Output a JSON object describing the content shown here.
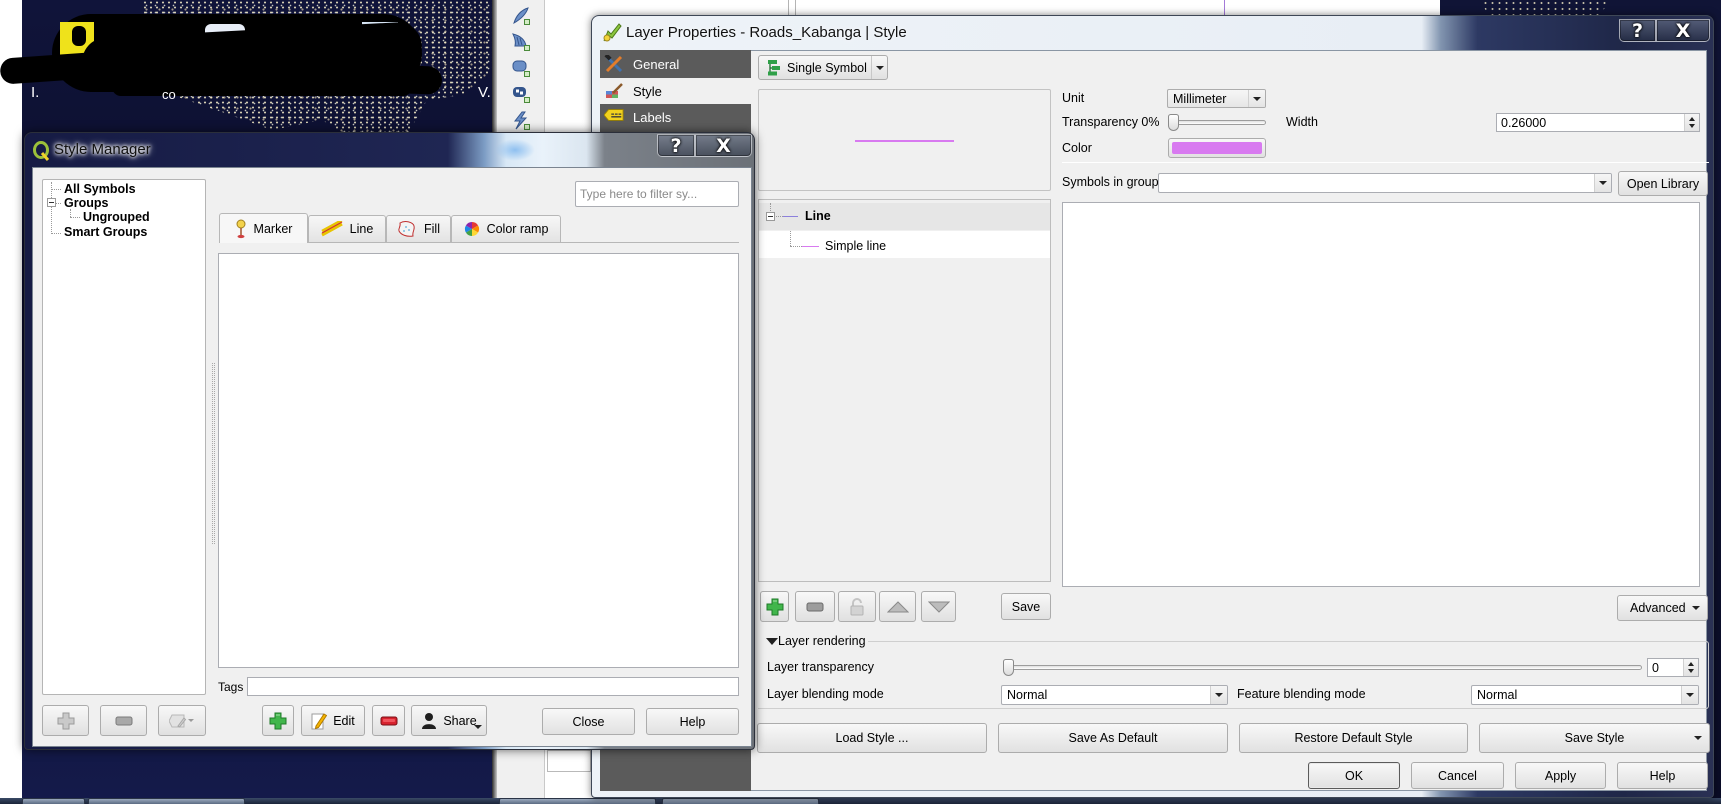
{
  "desktop": {
    "map_labels": [
      "I.",
      "co",
      "V."
    ]
  },
  "layer_properties": {
    "title": "Layer Properties - Roads_Kabanga | Style",
    "caption_help": "?",
    "caption_close": "X",
    "sidebar": [
      {
        "label": "General",
        "icon": "tools-icon",
        "selected": false
      },
      {
        "label": "Style",
        "icon": "paintbrush-icon",
        "selected": true
      },
      {
        "label": "Labels",
        "icon": "abc-tag-icon",
        "selected": false
      }
    ],
    "renderer_type": "Single Symbol",
    "symbol_tree": {
      "root": "Line",
      "child": "Simple line"
    },
    "save_label": "Save",
    "unit_label": "Unit",
    "unit_value": "Millimeter",
    "transparency_label": "Transparency 0%",
    "transparency_percent": 0,
    "width_label": "Width",
    "width_value": "0.26000",
    "color_label": "Color",
    "symbol_color": "#d87af0",
    "root_line_color": "#8c80dc",
    "symbols_in_group_label": "Symbols in group",
    "symbols_in_group_value": "",
    "open_library_label": "Open Library",
    "advanced_label": "Advanced",
    "layer_rendering": {
      "title": "Layer rendering",
      "transparency_label": "Layer transparency",
      "transparency_value": "0",
      "blending_label": "Layer blending mode",
      "blending_value": "Normal",
      "feature_blending_label": "Feature blending mode",
      "feature_blending_value": "Normal"
    },
    "style_buttons": {
      "load": "Load Style ...",
      "save_default": "Save As Default",
      "restore_default": "Restore Default Style",
      "save_style": "Save Style"
    },
    "buttons": {
      "ok": "OK",
      "cancel": "Cancel",
      "apply": "Apply",
      "help": "Help"
    }
  },
  "style_manager": {
    "title": "Style Manager",
    "caption_help": "?",
    "caption_close": "X",
    "groups_tree": [
      {
        "label": "All Symbols",
        "level": 0
      },
      {
        "label": "Groups",
        "level": 0,
        "expanded": true
      },
      {
        "label": "Ungrouped",
        "level": 1
      },
      {
        "label": "Smart Groups",
        "level": 0
      }
    ],
    "filter_placeholder": "Type here to filter sy...",
    "tabs": [
      {
        "label": "Marker",
        "active": true
      },
      {
        "label": "Line",
        "active": false
      },
      {
        "label": "Fill",
        "active": false
      },
      {
        "label": "Color ramp",
        "active": false
      }
    ],
    "tags_label": "Tags",
    "tags_value": "",
    "edit_label": "Edit",
    "share_label": "Share",
    "close_label": "Close",
    "help_label": "Help"
  }
}
